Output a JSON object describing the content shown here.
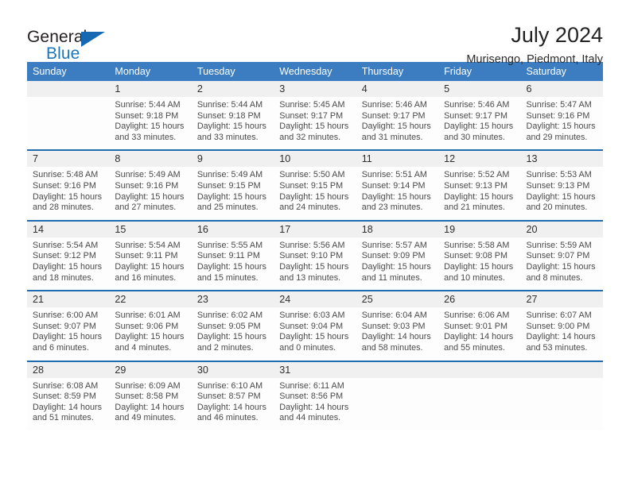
{
  "brand": {
    "name_part1": "General",
    "name_part2": "Blue",
    "triangle_icon": "triangle-icon",
    "color": "#1b75bb"
  },
  "header": {
    "title": "July 2024",
    "subtitle": "Murisengo, Piedmont, Italy"
  },
  "calendar": {
    "header_bg": "#3b7dc0",
    "separator_color": "#1f6cb0",
    "daynum_bg": "#f0f0f0",
    "weekdays": [
      "Sunday",
      "Monday",
      "Tuesday",
      "Wednesday",
      "Thursday",
      "Friday",
      "Saturday"
    ],
    "weeks": [
      [
        {
          "day": "",
          "lines": []
        },
        {
          "day": "1",
          "lines": [
            "Sunrise: 5:44 AM",
            "Sunset: 9:18 PM",
            "Daylight: 15 hours",
            "and 33 minutes."
          ]
        },
        {
          "day": "2",
          "lines": [
            "Sunrise: 5:44 AM",
            "Sunset: 9:18 PM",
            "Daylight: 15 hours",
            "and 33 minutes."
          ]
        },
        {
          "day": "3",
          "lines": [
            "Sunrise: 5:45 AM",
            "Sunset: 9:17 PM",
            "Daylight: 15 hours",
            "and 32 minutes."
          ]
        },
        {
          "day": "4",
          "lines": [
            "Sunrise: 5:46 AM",
            "Sunset: 9:17 PM",
            "Daylight: 15 hours",
            "and 31 minutes."
          ]
        },
        {
          "day": "5",
          "lines": [
            "Sunrise: 5:46 AM",
            "Sunset: 9:17 PM",
            "Daylight: 15 hours",
            "and 30 minutes."
          ]
        },
        {
          "day": "6",
          "lines": [
            "Sunrise: 5:47 AM",
            "Sunset: 9:16 PM",
            "Daylight: 15 hours",
            "and 29 minutes."
          ]
        }
      ],
      [
        {
          "day": "7",
          "lines": [
            "Sunrise: 5:48 AM",
            "Sunset: 9:16 PM",
            "Daylight: 15 hours",
            "and 28 minutes."
          ]
        },
        {
          "day": "8",
          "lines": [
            "Sunrise: 5:49 AM",
            "Sunset: 9:16 PM",
            "Daylight: 15 hours",
            "and 27 minutes."
          ]
        },
        {
          "day": "9",
          "lines": [
            "Sunrise: 5:49 AM",
            "Sunset: 9:15 PM",
            "Daylight: 15 hours",
            "and 25 minutes."
          ]
        },
        {
          "day": "10",
          "lines": [
            "Sunrise: 5:50 AM",
            "Sunset: 9:15 PM",
            "Daylight: 15 hours",
            "and 24 minutes."
          ]
        },
        {
          "day": "11",
          "lines": [
            "Sunrise: 5:51 AM",
            "Sunset: 9:14 PM",
            "Daylight: 15 hours",
            "and 23 minutes."
          ]
        },
        {
          "day": "12",
          "lines": [
            "Sunrise: 5:52 AM",
            "Sunset: 9:13 PM",
            "Daylight: 15 hours",
            "and 21 minutes."
          ]
        },
        {
          "day": "13",
          "lines": [
            "Sunrise: 5:53 AM",
            "Sunset: 9:13 PM",
            "Daylight: 15 hours",
            "and 20 minutes."
          ]
        }
      ],
      [
        {
          "day": "14",
          "lines": [
            "Sunrise: 5:54 AM",
            "Sunset: 9:12 PM",
            "Daylight: 15 hours",
            "and 18 minutes."
          ]
        },
        {
          "day": "15",
          "lines": [
            "Sunrise: 5:54 AM",
            "Sunset: 9:11 PM",
            "Daylight: 15 hours",
            "and 16 minutes."
          ]
        },
        {
          "day": "16",
          "lines": [
            "Sunrise: 5:55 AM",
            "Sunset: 9:11 PM",
            "Daylight: 15 hours",
            "and 15 minutes."
          ]
        },
        {
          "day": "17",
          "lines": [
            "Sunrise: 5:56 AM",
            "Sunset: 9:10 PM",
            "Daylight: 15 hours",
            "and 13 minutes."
          ]
        },
        {
          "day": "18",
          "lines": [
            "Sunrise: 5:57 AM",
            "Sunset: 9:09 PM",
            "Daylight: 15 hours",
            "and 11 minutes."
          ]
        },
        {
          "day": "19",
          "lines": [
            "Sunrise: 5:58 AM",
            "Sunset: 9:08 PM",
            "Daylight: 15 hours",
            "and 10 minutes."
          ]
        },
        {
          "day": "20",
          "lines": [
            "Sunrise: 5:59 AM",
            "Sunset: 9:07 PM",
            "Daylight: 15 hours",
            "and 8 minutes."
          ]
        }
      ],
      [
        {
          "day": "21",
          "lines": [
            "Sunrise: 6:00 AM",
            "Sunset: 9:07 PM",
            "Daylight: 15 hours",
            "and 6 minutes."
          ]
        },
        {
          "day": "22",
          "lines": [
            "Sunrise: 6:01 AM",
            "Sunset: 9:06 PM",
            "Daylight: 15 hours",
            "and 4 minutes."
          ]
        },
        {
          "day": "23",
          "lines": [
            "Sunrise: 6:02 AM",
            "Sunset: 9:05 PM",
            "Daylight: 15 hours",
            "and 2 minutes."
          ]
        },
        {
          "day": "24",
          "lines": [
            "Sunrise: 6:03 AM",
            "Sunset: 9:04 PM",
            "Daylight: 15 hours",
            "and 0 minutes."
          ]
        },
        {
          "day": "25",
          "lines": [
            "Sunrise: 6:04 AM",
            "Sunset: 9:03 PM",
            "Daylight: 14 hours",
            "and 58 minutes."
          ]
        },
        {
          "day": "26",
          "lines": [
            "Sunrise: 6:06 AM",
            "Sunset: 9:01 PM",
            "Daylight: 14 hours",
            "and 55 minutes."
          ]
        },
        {
          "day": "27",
          "lines": [
            "Sunrise: 6:07 AM",
            "Sunset: 9:00 PM",
            "Daylight: 14 hours",
            "and 53 minutes."
          ]
        }
      ],
      [
        {
          "day": "28",
          "lines": [
            "Sunrise: 6:08 AM",
            "Sunset: 8:59 PM",
            "Daylight: 14 hours",
            "and 51 minutes."
          ]
        },
        {
          "day": "29",
          "lines": [
            "Sunrise: 6:09 AM",
            "Sunset: 8:58 PM",
            "Daylight: 14 hours",
            "and 49 minutes."
          ]
        },
        {
          "day": "30",
          "lines": [
            "Sunrise: 6:10 AM",
            "Sunset: 8:57 PM",
            "Daylight: 14 hours",
            "and 46 minutes."
          ]
        },
        {
          "day": "31",
          "lines": [
            "Sunrise: 6:11 AM",
            "Sunset: 8:56 PM",
            "Daylight: 14 hours",
            "and 44 minutes."
          ]
        },
        {
          "day": "",
          "lines": []
        },
        {
          "day": "",
          "lines": []
        },
        {
          "day": "",
          "lines": []
        }
      ]
    ]
  }
}
